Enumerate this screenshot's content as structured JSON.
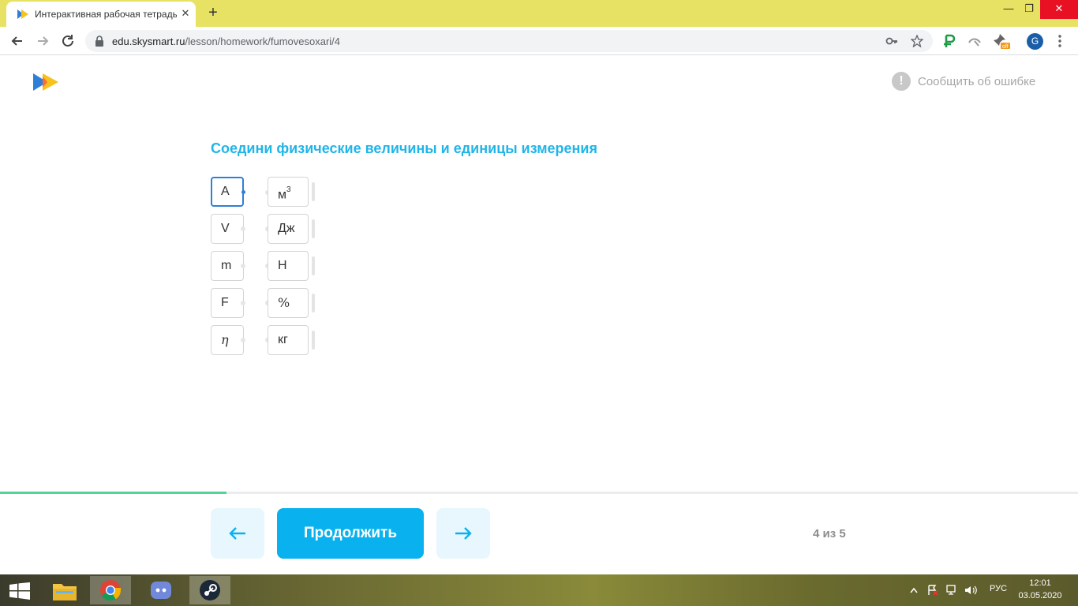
{
  "browser": {
    "tab_title": "Интерактивная рабочая тетрадь",
    "tab_close": "✕",
    "new_tab": "+",
    "url_domain": "edu.skysmart.ru",
    "url_path": "/lesson/homework/fumovesoxari/4",
    "profile_initial": "G",
    "window_min": "—",
    "window_max": "❐",
    "window_close": "✕"
  },
  "page": {
    "report_icon": "!",
    "report_label": "Сообщить об ошибке",
    "task_title": "Соедини физические величины и единицы измерения",
    "left_items": [
      "A",
      "V",
      "m",
      "F",
      "η"
    ],
    "right_items": [
      {
        "base": "м",
        "sup": "3"
      },
      {
        "base": "Дж",
        "sup": ""
      },
      {
        "base": "Н",
        "sup": ""
      },
      {
        "base": "%",
        "sup": ""
      },
      {
        "base": "кг",
        "sup": ""
      }
    ],
    "continue_label": "Продолжить",
    "page_count": "4 из 5",
    "progress": 0.21
  },
  "taskbar": {
    "lang": "РУС",
    "time": "12:01",
    "date": "03.05.2020"
  },
  "colors": {
    "accent": "#09b2ef",
    "title": "#1fb5e9",
    "progress": "#53d496",
    "tabbar": "#e8e264"
  }
}
